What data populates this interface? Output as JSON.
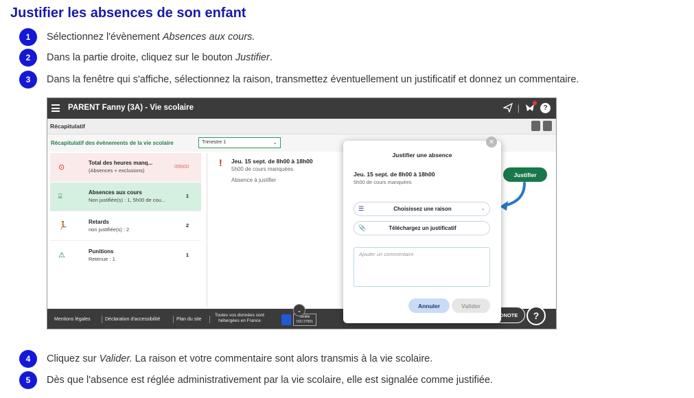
{
  "page": {
    "title": "Justifier les absences de son enfant"
  },
  "steps": [
    {
      "number": "1",
      "text_before": "Sélectionnez l'évènement ",
      "emphasis": "Absences aux cours.",
      "text_after": ""
    },
    {
      "number": "2",
      "text_before": "Dans la partie droite, cliquez sur le bouton ",
      "emphasis": "Justifier",
      "text_after": "."
    },
    {
      "number": "3",
      "text_before": "Dans la fenêtre qui s'affiche, sélectionnez la raison, transmettez éventuellement un justificatif et donnez un commentaire.",
      "emphasis": "",
      "text_after": ""
    },
    {
      "number": "4",
      "text_before": "Cliquez sur ",
      "emphasis": "Valider.",
      "text_after": " La raison et votre commentaire sont alors transmis à la vie scolaire."
    },
    {
      "number": "5",
      "text_before": "Dès que l'absence est réglée administrativement par la vie scolaire, elle est signalée comme justifiée.",
      "emphasis": "",
      "text_after": ""
    }
  ],
  "screenshot": {
    "app_title": "PARENT Fanny (3A) - Vie scolaire",
    "recap_title": "Récapitulatif",
    "filter_label": "Récapitulatif des évènements de la vie scolaire",
    "filter_value": "Trimestre 1",
    "sidebar": [
      {
        "icon": "clock-icon",
        "title": "Total des heures manq...",
        "subtitle": "(Absences + exclusions)",
        "value": "05h00"
      },
      {
        "icon": "desk-icon",
        "title": "Absences aux cours",
        "subtitle": "Non justifiée(s) : 1, 5h00 de cou...",
        "value": "1"
      },
      {
        "icon": "runner-icon",
        "title": "Retards",
        "subtitle": "non justifiée(s) : 2",
        "value": "2"
      },
      {
        "icon": "warning-icon",
        "title": "Punitions",
        "subtitle": "Retenue : 1",
        "value": "1"
      }
    ],
    "detail": {
      "date": "Jeu. 15 sept. de 8h00 à 18h00",
      "hours": "5h00 de cours manquées",
      "status": "Absence à justifier"
    },
    "justifier_button": "Justifier",
    "footer": {
      "links": [
        "Mentions légales",
        "Déclaration d'accessibilité",
        "Plan du site"
      ],
      "hosted_line1": "Toutes vos données sont",
      "hosted_line2": "hébergées en France",
      "cert_line1": "certifié",
      "cert_line2": "ISO 27001",
      "note_label": "ONOTE",
      "help_label": "?"
    },
    "modal": {
      "title": "Justifier une absence",
      "date": "Jeu. 15 sept. de 8h00 à 18h00",
      "hours": "5h00 de cours manquées",
      "reason_placeholder": "Choisissez une raison",
      "upload_label": "Téléchargez un justificatif",
      "comment_placeholder": "Ajouter un commentaire",
      "cancel_label": "Annuler",
      "validate_label": "Valider"
    },
    "colors": {
      "topbar": "#3b3b3b",
      "green": "#19784a",
      "selected": "#d5efe0",
      "accent_blue": "#1518d6"
    }
  }
}
